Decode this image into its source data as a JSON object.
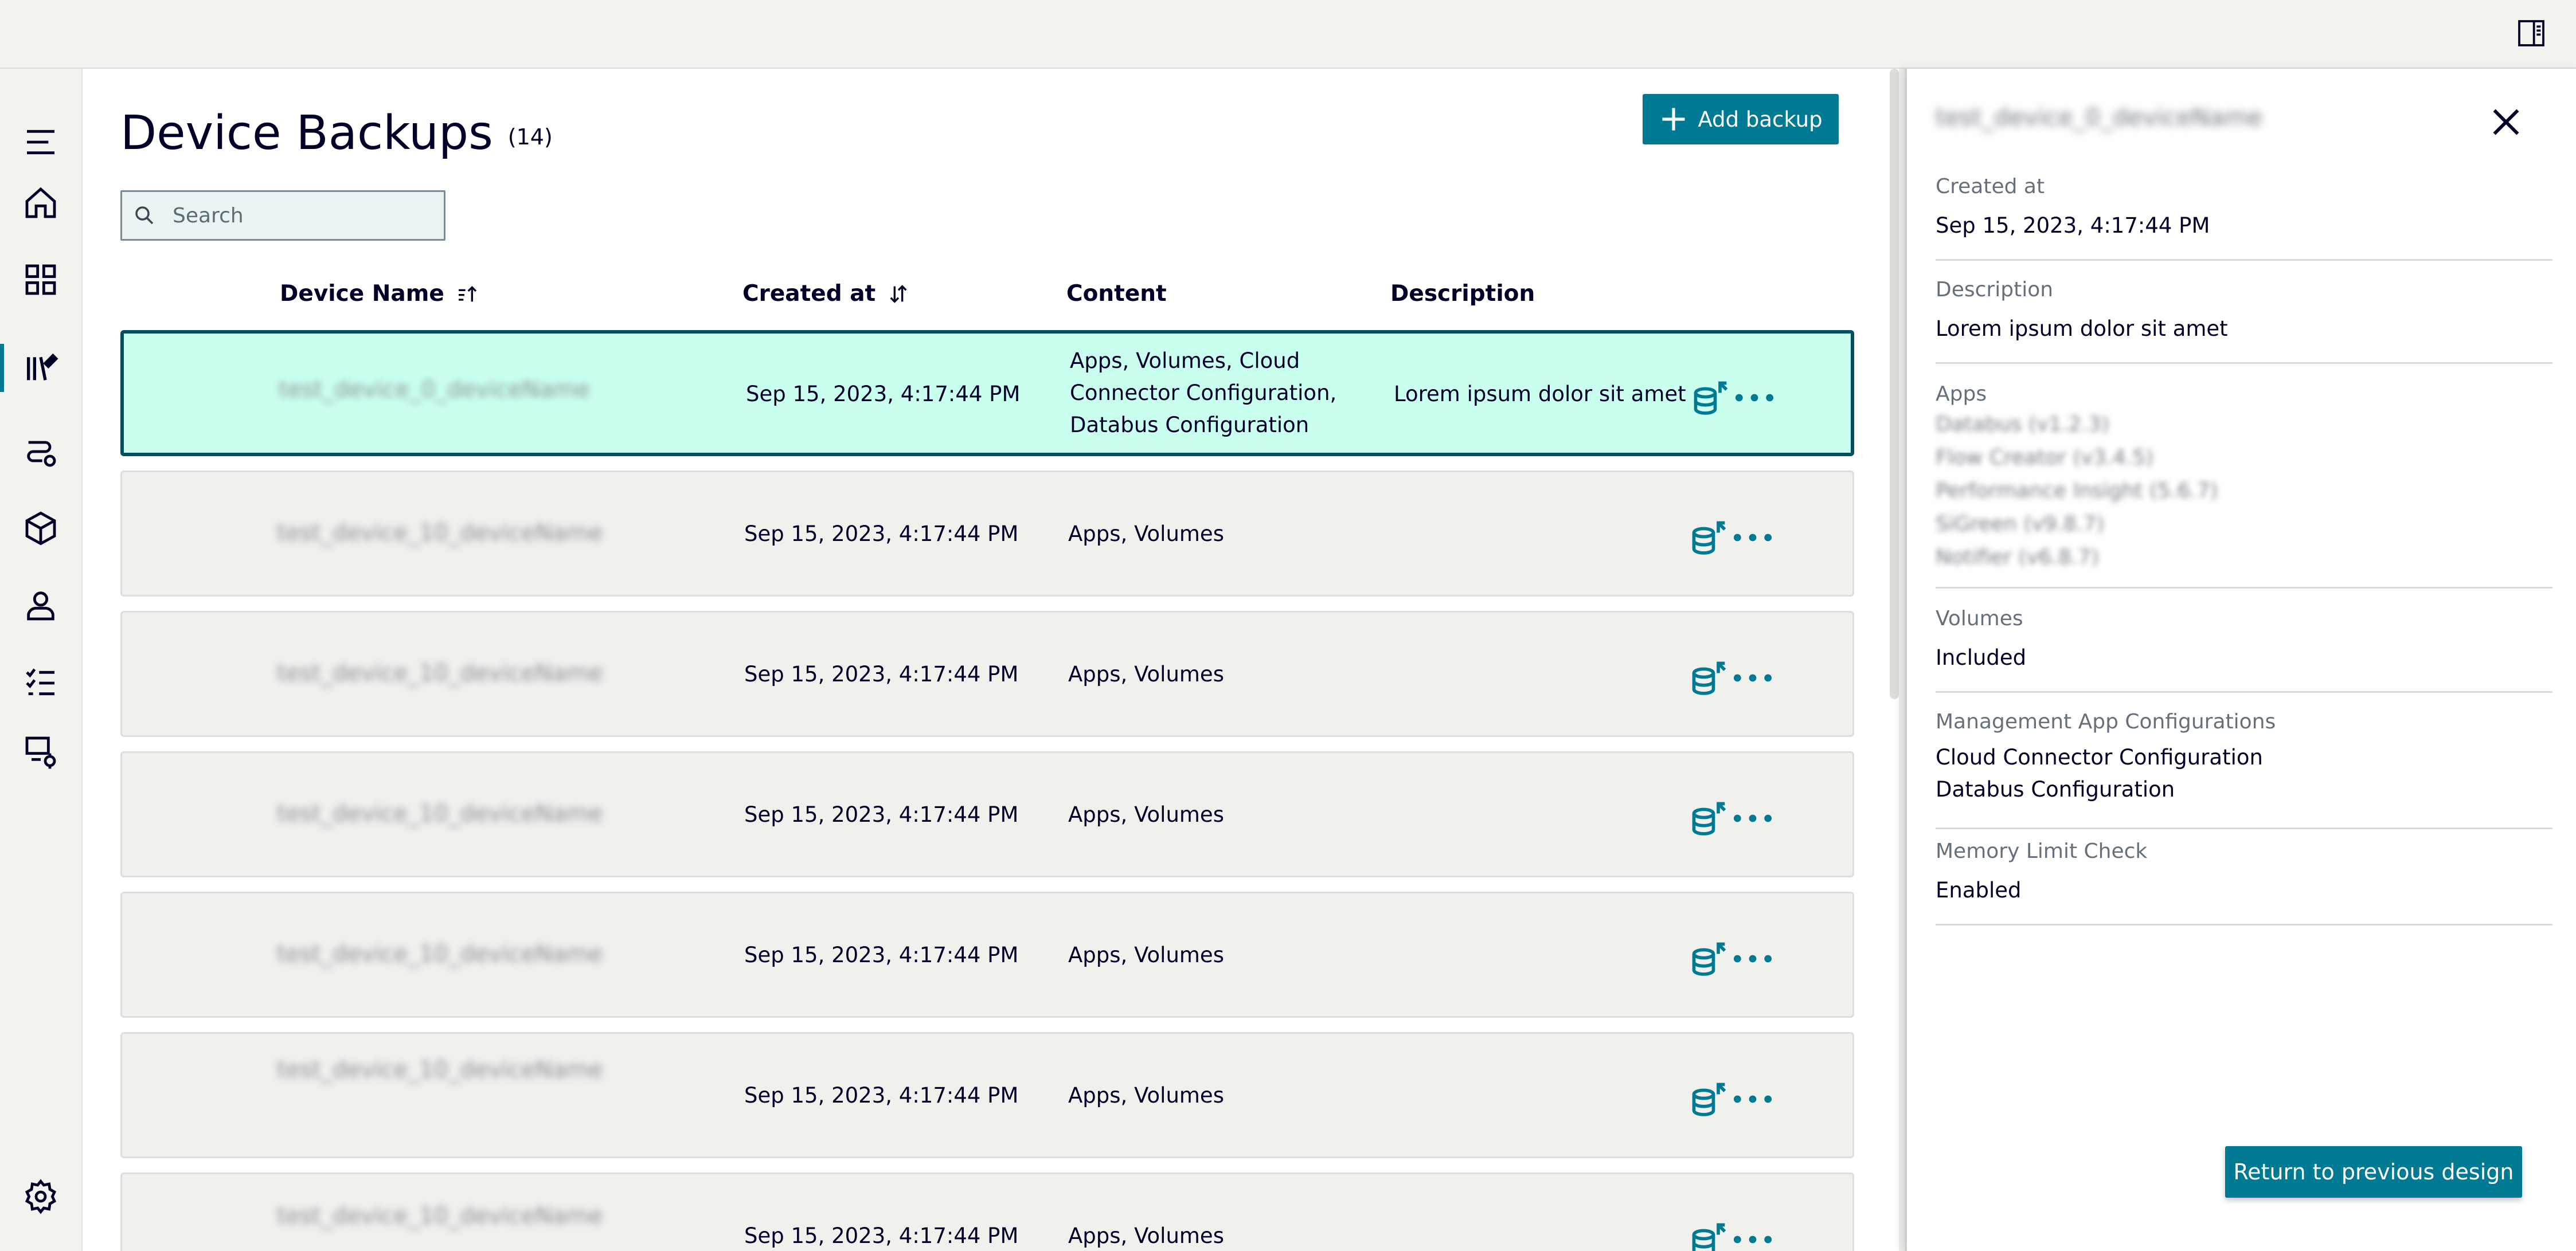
{
  "header": {
    "panel_toggle_icon": "side-panel-icon"
  },
  "sidebar": {
    "items": [
      {
        "name": "menu",
        "icon": "hamburger-menu-icon"
      },
      {
        "name": "home",
        "icon": "home-icon"
      },
      {
        "name": "dashboard",
        "icon": "grid-icon"
      },
      {
        "name": "backups",
        "icon": "library-edit-icon",
        "active": true
      },
      {
        "name": "connections",
        "icon": "cable-icon"
      },
      {
        "name": "apps",
        "icon": "cube-icon"
      },
      {
        "name": "users",
        "icon": "user-icon"
      },
      {
        "name": "tasks",
        "icon": "checklist-icon"
      },
      {
        "name": "devices",
        "icon": "device-settings-icon"
      },
      {
        "name": "settings",
        "icon": "gear-icon"
      }
    ]
  },
  "page": {
    "title": "Device Backups",
    "count": "(14)",
    "add_button": "Add backup",
    "search_placeholder": "Search"
  },
  "table": {
    "columns": [
      "Device Name",
      "Created at",
      "Content",
      "Description"
    ],
    "rows": [
      {
        "device": "test_device_0_deviceName",
        "created": "Sep 15, 2023, 4:17:44 PM",
        "content": "Apps, Volumes, Cloud Connector Configuration, Databus Configuration",
        "description": "Lorem ipsum dolor sit amet",
        "selected": true
      },
      {
        "device": "test_device_10_deviceName",
        "created": "Sep 15, 2023, 4:17:44 PM",
        "content": "Apps, Volumes",
        "description": ""
      },
      {
        "device": "test_device_10_deviceName",
        "created": "Sep 15, 2023, 4:17:44 PM",
        "content": "Apps, Volumes",
        "description": ""
      },
      {
        "device": "test_device_10_deviceName",
        "created": "Sep 15, 2023, 4:17:44 PM",
        "content": "Apps, Volumes",
        "description": ""
      },
      {
        "device": "test_device_10_deviceName",
        "created": "Sep 15, 2023, 4:17:44 PM",
        "content": "Apps, Volumes",
        "description": ""
      },
      {
        "device": "test_device_10_deviceName",
        "created": "Sep 15, 2023, 4:17:44 PM",
        "content": "Apps, Volumes",
        "description": ""
      },
      {
        "device": "test_device_10_deviceName",
        "created": "Sep 15, 2023, 4:17:44 PM",
        "content": "Apps, Volumes",
        "description": ""
      }
    ]
  },
  "details": {
    "header": "test_device_0_deviceName",
    "created_label": "Created at",
    "created_value": "Sep 15, 2023, 4:17:44 PM",
    "description_label": "Description",
    "description_value": "Lorem ipsum dolor sit amet",
    "apps_label": "Apps",
    "apps": [
      "Databus (v1.2.3)",
      "Flow Creator (v3.4.5)",
      "Performance Insight (5.6.7)",
      "SiGreen (v9.8.7)",
      "Notifier (v6.8.7)"
    ],
    "volumes_label": "Volumes",
    "volumes_value": "Included",
    "mgmt_label": "Management App Configurations",
    "mgmt_values": [
      "Cloud Connector Configuration",
      "Databus Configuration"
    ],
    "memory_label": "Memory Limit Check",
    "memory_value": "Enabled"
  },
  "footer": {
    "return_button": "Return to previous design"
  },
  "colors": {
    "accent": "#007993",
    "selected_row": "#cafff0",
    "selected_border": "#00505f",
    "text": "#000028"
  }
}
